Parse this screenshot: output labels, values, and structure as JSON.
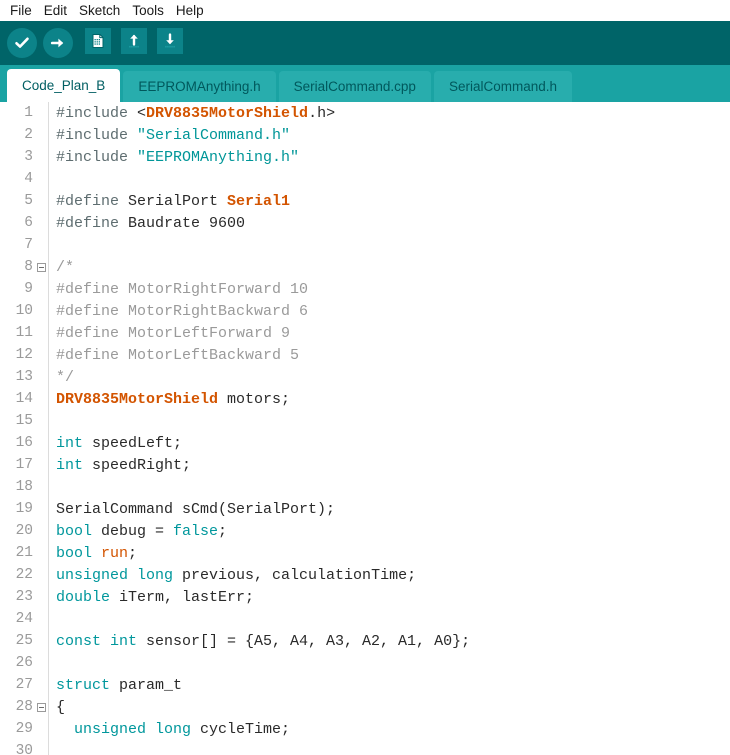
{
  "menubar": {
    "items": [
      {
        "label": "File"
      },
      {
        "label": "Edit"
      },
      {
        "label": "Sketch"
      },
      {
        "label": "Tools"
      },
      {
        "label": "Help"
      }
    ]
  },
  "toolbar": {
    "background": "#006468",
    "buttons": [
      {
        "name": "verify-button",
        "icon": "checkmark-circle-icon",
        "shape": "circle"
      },
      {
        "name": "upload-button",
        "icon": "arrow-right-circle-icon",
        "shape": "circle"
      },
      {
        "name": "new-sketch-button",
        "icon": "new-document-icon",
        "shape": "square"
      },
      {
        "name": "open-sketch-button",
        "icon": "arrow-up-open-icon",
        "shape": "square"
      },
      {
        "name": "save-sketch-button",
        "icon": "arrow-down-save-icon",
        "shape": "square"
      }
    ]
  },
  "tabbar": {
    "background": "#1aa3a3",
    "active_background": "#ffffff",
    "tabs": [
      {
        "label": "Code_Plan_B",
        "active": true
      },
      {
        "label": "EEPROMAnything.h",
        "active": false
      },
      {
        "label": "SerialCommand.cpp",
        "active": false
      },
      {
        "label": "SerialCommand.h",
        "active": false
      }
    ]
  },
  "editor": {
    "colors": {
      "preprocessor": "#5e6d70",
      "library": "#d35400",
      "string": "#009698",
      "keyword": "#00979c",
      "comment": "#9a9a9a",
      "plain": "#2a2a2a",
      "gutter": "#9a9a9a"
    },
    "lines": [
      {
        "n": "1",
        "fold": false,
        "tokens": [
          {
            "t": "#include ",
            "c": "t-pre"
          },
          {
            "t": "<",
            "c": "t-plain"
          },
          {
            "t": "DRV8835MotorShield",
            "c": "t-lib"
          },
          {
            "t": ".h>",
            "c": "t-plain"
          }
        ]
      },
      {
        "n": "2",
        "fold": false,
        "tokens": [
          {
            "t": "#include ",
            "c": "t-pre"
          },
          {
            "t": "\"SerialCommand.h\"",
            "c": "t-str"
          }
        ]
      },
      {
        "n": "3",
        "fold": false,
        "tokens": [
          {
            "t": "#include ",
            "c": "t-pre"
          },
          {
            "t": "\"EEPROMAnything.h\"",
            "c": "t-str"
          }
        ]
      },
      {
        "n": "4",
        "fold": false,
        "tokens": []
      },
      {
        "n": "5",
        "fold": false,
        "tokens": [
          {
            "t": "#define",
            "c": "t-pre"
          },
          {
            "t": " SerialPort ",
            "c": "t-plain"
          },
          {
            "t": "Serial1",
            "c": "t-lib"
          }
        ]
      },
      {
        "n": "6",
        "fold": false,
        "tokens": [
          {
            "t": "#define",
            "c": "t-pre"
          },
          {
            "t": " Baudrate 9600",
            "c": "t-plain"
          }
        ]
      },
      {
        "n": "7",
        "fold": false,
        "tokens": []
      },
      {
        "n": "8",
        "fold": true,
        "tokens": [
          {
            "t": "/*",
            "c": "t-cmt"
          }
        ]
      },
      {
        "n": "9",
        "fold": false,
        "tokens": [
          {
            "t": "#define MotorRightForward 10",
            "c": "t-cmt"
          }
        ]
      },
      {
        "n": "10",
        "fold": false,
        "tokens": [
          {
            "t": "#define MotorRightBackward 6",
            "c": "t-cmt"
          }
        ]
      },
      {
        "n": "11",
        "fold": false,
        "tokens": [
          {
            "t": "#define MotorLeftForward 9",
            "c": "t-cmt"
          }
        ]
      },
      {
        "n": "12",
        "fold": false,
        "tokens": [
          {
            "t": "#define MotorLeftBackward 5",
            "c": "t-cmt"
          }
        ]
      },
      {
        "n": "13",
        "fold": false,
        "tokens": [
          {
            "t": "*/",
            "c": "t-cmt"
          }
        ]
      },
      {
        "n": "14",
        "fold": false,
        "tokens": [
          {
            "t": "DRV8835MotorShield",
            "c": "t-lib"
          },
          {
            "t": " motors;",
            "c": "t-plain"
          }
        ]
      },
      {
        "n": "15",
        "fold": false,
        "tokens": []
      },
      {
        "n": "16",
        "fold": false,
        "tokens": [
          {
            "t": "int",
            "c": "t-key"
          },
          {
            "t": " speedLeft;",
            "c": "t-plain"
          }
        ]
      },
      {
        "n": "17",
        "fold": false,
        "tokens": [
          {
            "t": "int",
            "c": "t-key"
          },
          {
            "t": " speedRight;",
            "c": "t-plain"
          }
        ]
      },
      {
        "n": "18",
        "fold": false,
        "tokens": []
      },
      {
        "n": "19",
        "fold": false,
        "tokens": [
          {
            "t": "SerialCommand sCmd(SerialPort);",
            "c": "t-plain"
          }
        ]
      },
      {
        "n": "20",
        "fold": false,
        "tokens": [
          {
            "t": "bool",
            "c": "t-key"
          },
          {
            "t": " debug = ",
            "c": "t-plain"
          },
          {
            "t": "false",
            "c": "t-key"
          },
          {
            "t": ";",
            "c": "t-plain"
          }
        ]
      },
      {
        "n": "21",
        "fold": false,
        "tokens": [
          {
            "t": "bool",
            "c": "t-key"
          },
          {
            "t": " ",
            "c": "t-plain"
          },
          {
            "t": "run",
            "c": "t-kw2"
          },
          {
            "t": ";",
            "c": "t-plain"
          }
        ]
      },
      {
        "n": "22",
        "fold": false,
        "tokens": [
          {
            "t": "unsigned long",
            "c": "t-key"
          },
          {
            "t": " previous, calculationTime;",
            "c": "t-plain"
          }
        ]
      },
      {
        "n": "23",
        "fold": false,
        "tokens": [
          {
            "t": "double",
            "c": "t-key"
          },
          {
            "t": " iTerm, lastErr;",
            "c": "t-plain"
          }
        ]
      },
      {
        "n": "24",
        "fold": false,
        "tokens": []
      },
      {
        "n": "25",
        "fold": false,
        "tokens": [
          {
            "t": "const int",
            "c": "t-key"
          },
          {
            "t": " sensor[] = {A5, A4, A3, A2, A1, A0};",
            "c": "t-plain"
          }
        ]
      },
      {
        "n": "26",
        "fold": false,
        "tokens": []
      },
      {
        "n": "27",
        "fold": false,
        "tokens": [
          {
            "t": "struct",
            "c": "t-key"
          },
          {
            "t": " param_t",
            "c": "t-plain"
          }
        ]
      },
      {
        "n": "28",
        "fold": true,
        "tokens": [
          {
            "t": "{",
            "c": "t-plain"
          }
        ]
      },
      {
        "n": "29",
        "fold": false,
        "tokens": [
          {
            "t": "  ",
            "c": "t-plain"
          },
          {
            "t": "unsigned long",
            "c": "t-key"
          },
          {
            "t": " cycleTime;",
            "c": "t-plain"
          }
        ]
      },
      {
        "n": "30",
        "fold": false,
        "tokens": []
      }
    ]
  }
}
